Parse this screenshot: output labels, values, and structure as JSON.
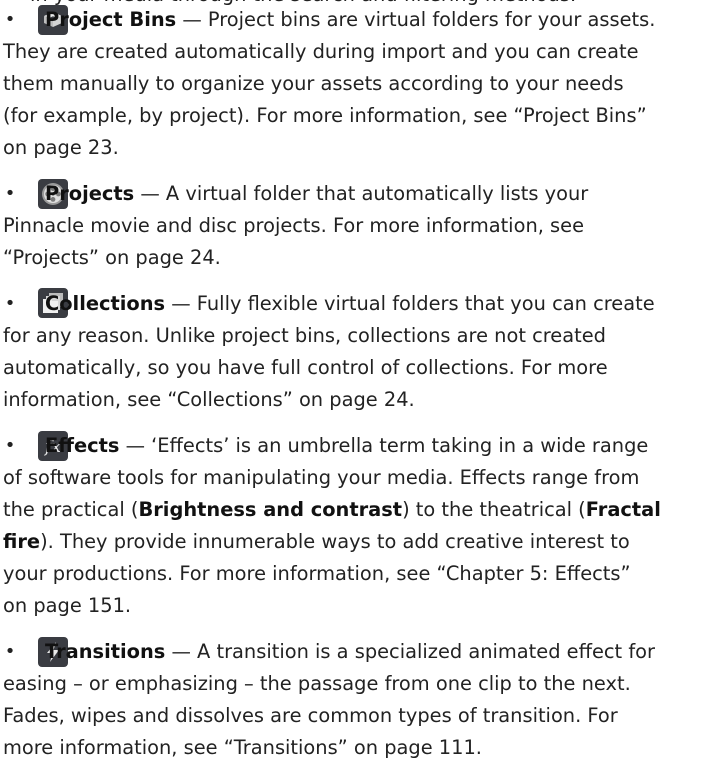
{
  "top_line": "in your media through the search and filtering methods.",
  "items": [
    {
      "icon": "project-bins-icon",
      "title": "Project Bins",
      "lines": [
        " — Project bins are virtual folders for your assets.",
        "They are created automatically during import and you can create",
        "them manually to organize your assets according to your needs",
        "(for example, by project). For more information, see “Project Bins”",
        "on page 23."
      ]
    },
    {
      "icon": "projects-icon",
      "title": "Projects",
      "lines": [
        " — A virtual folder that automatically lists your",
        "Pinnacle movie and disc projects. For more information, see",
        "“Projects” on page 24."
      ]
    },
    {
      "icon": "collections-icon",
      "title": "Collections",
      "lines": [
        " — Fully flexible virtual folders that you can create",
        "for any reason. Unlike project bins, collections are not created",
        "automatically, so you have full control of collections. For more",
        "information, see “Collections” on page 24."
      ]
    },
    {
      "icon": "effects-icon",
      "title": "Effects",
      "line1": " — ‘Effects’ is an umbrella term taking in a wide range",
      "line2": "of software tools for manipulating your media. Effects range from",
      "line3_a": "the practical (",
      "line3_b": "Brightness and contrast",
      "line3_c": ") to the theatrical (",
      "line3_d": "Fractal",
      "line4_a": "fire",
      "line4_b": "). They provide innumerable ways to add creative interest to",
      "line5": "your productions. For more information, see “Chapter 5: Effects”",
      "line6": "on page 151."
    },
    {
      "icon": "transitions-icon",
      "title": "Transitions",
      "lines": [
        " — A transition is a specialized animated effect for",
        "easing – or emphasizing – the passage from one clip to the next.",
        "Fades, wipes and dissolves are common types of transition. For",
        "more information, see “Transitions” on page 111."
      ]
    }
  ],
  "bullet_char": "•"
}
